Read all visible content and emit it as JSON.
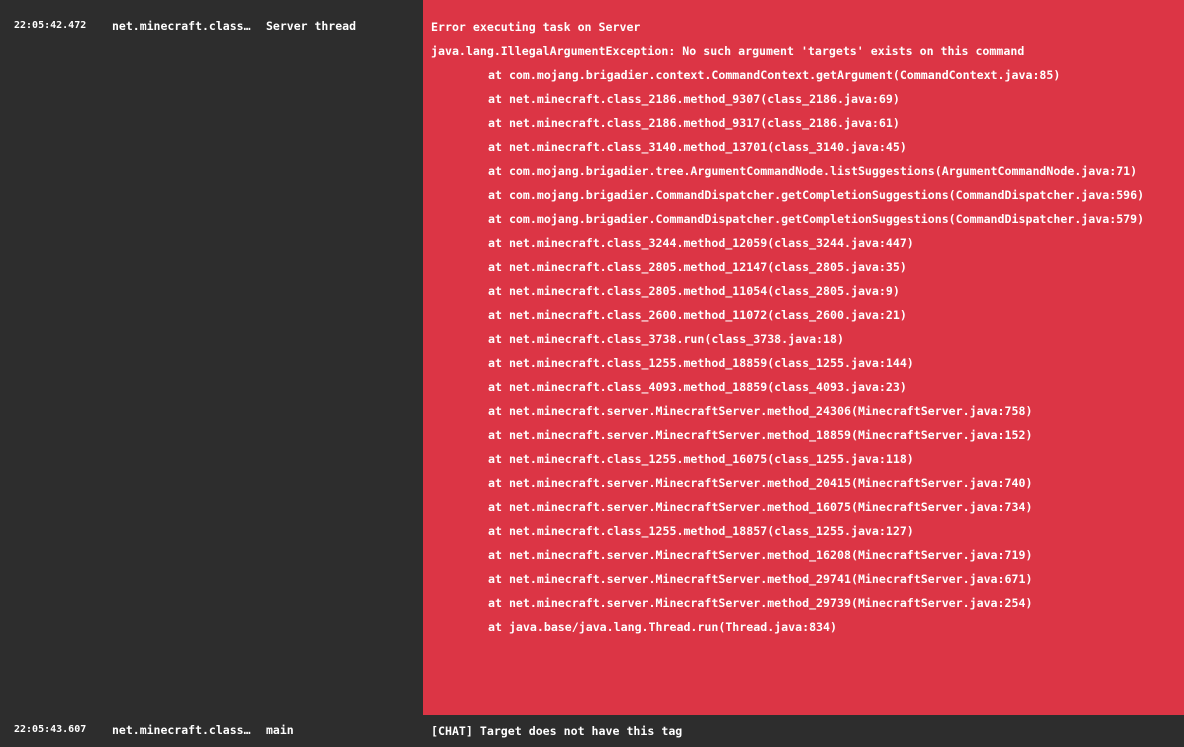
{
  "entries": [
    {
      "level": "error",
      "timestamp": "22:05:42.472",
      "logger": "net.minecraft.class_…",
      "thread": "Server thread",
      "message": "Error executing task on Server",
      "exception": "java.lang.IllegalArgumentException: No such argument 'targets' exists on this command",
      "stack": [
        "at com.mojang.brigadier.context.CommandContext.getArgument(CommandContext.java:85)",
        "at net.minecraft.class_2186.method_9307(class_2186.java:69)",
        "at net.minecraft.class_2186.method_9317(class_2186.java:61)",
        "at net.minecraft.class_3140.method_13701(class_3140.java:45)",
        "at com.mojang.brigadier.tree.ArgumentCommandNode.listSuggestions(ArgumentCommandNode.java:71)",
        "at com.mojang.brigadier.CommandDispatcher.getCompletionSuggestions(CommandDispatcher.java:596)",
        "at com.mojang.brigadier.CommandDispatcher.getCompletionSuggestions(CommandDispatcher.java:579)",
        "at net.minecraft.class_3244.method_12059(class_3244.java:447)",
        "at net.minecraft.class_2805.method_12147(class_2805.java:35)",
        "at net.minecraft.class_2805.method_11054(class_2805.java:9)",
        "at net.minecraft.class_2600.method_11072(class_2600.java:21)",
        "at net.minecraft.class_3738.run(class_3738.java:18)",
        "at net.minecraft.class_1255.method_18859(class_1255.java:144)",
        "at net.minecraft.class_4093.method_18859(class_4093.java:23)",
        "at net.minecraft.server.MinecraftServer.method_24306(MinecraftServer.java:758)",
        "at net.minecraft.server.MinecraftServer.method_18859(MinecraftServer.java:152)",
        "at net.minecraft.class_1255.method_16075(class_1255.java:118)",
        "at net.minecraft.server.MinecraftServer.method_20415(MinecraftServer.java:740)",
        "at net.minecraft.server.MinecraftServer.method_16075(MinecraftServer.java:734)",
        "at net.minecraft.class_1255.method_18857(class_1255.java:127)",
        "at net.minecraft.server.MinecraftServer.method_16208(MinecraftServer.java:719)",
        "at net.minecraft.server.MinecraftServer.method_29741(MinecraftServer.java:671)",
        "at net.minecraft.server.MinecraftServer.method_29739(MinecraftServer.java:254)",
        "at java.base/java.lang.Thread.run(Thread.java:834)"
      ]
    },
    {
      "level": "info",
      "timestamp": "22:05:43.607",
      "logger": "net.minecraft.class_…",
      "thread": "main",
      "message": "[CHAT] Target does not have this tag"
    }
  ],
  "colors": {
    "background": "#2d2d2d",
    "error_background": "#dc3545",
    "text": "#ffffff"
  }
}
